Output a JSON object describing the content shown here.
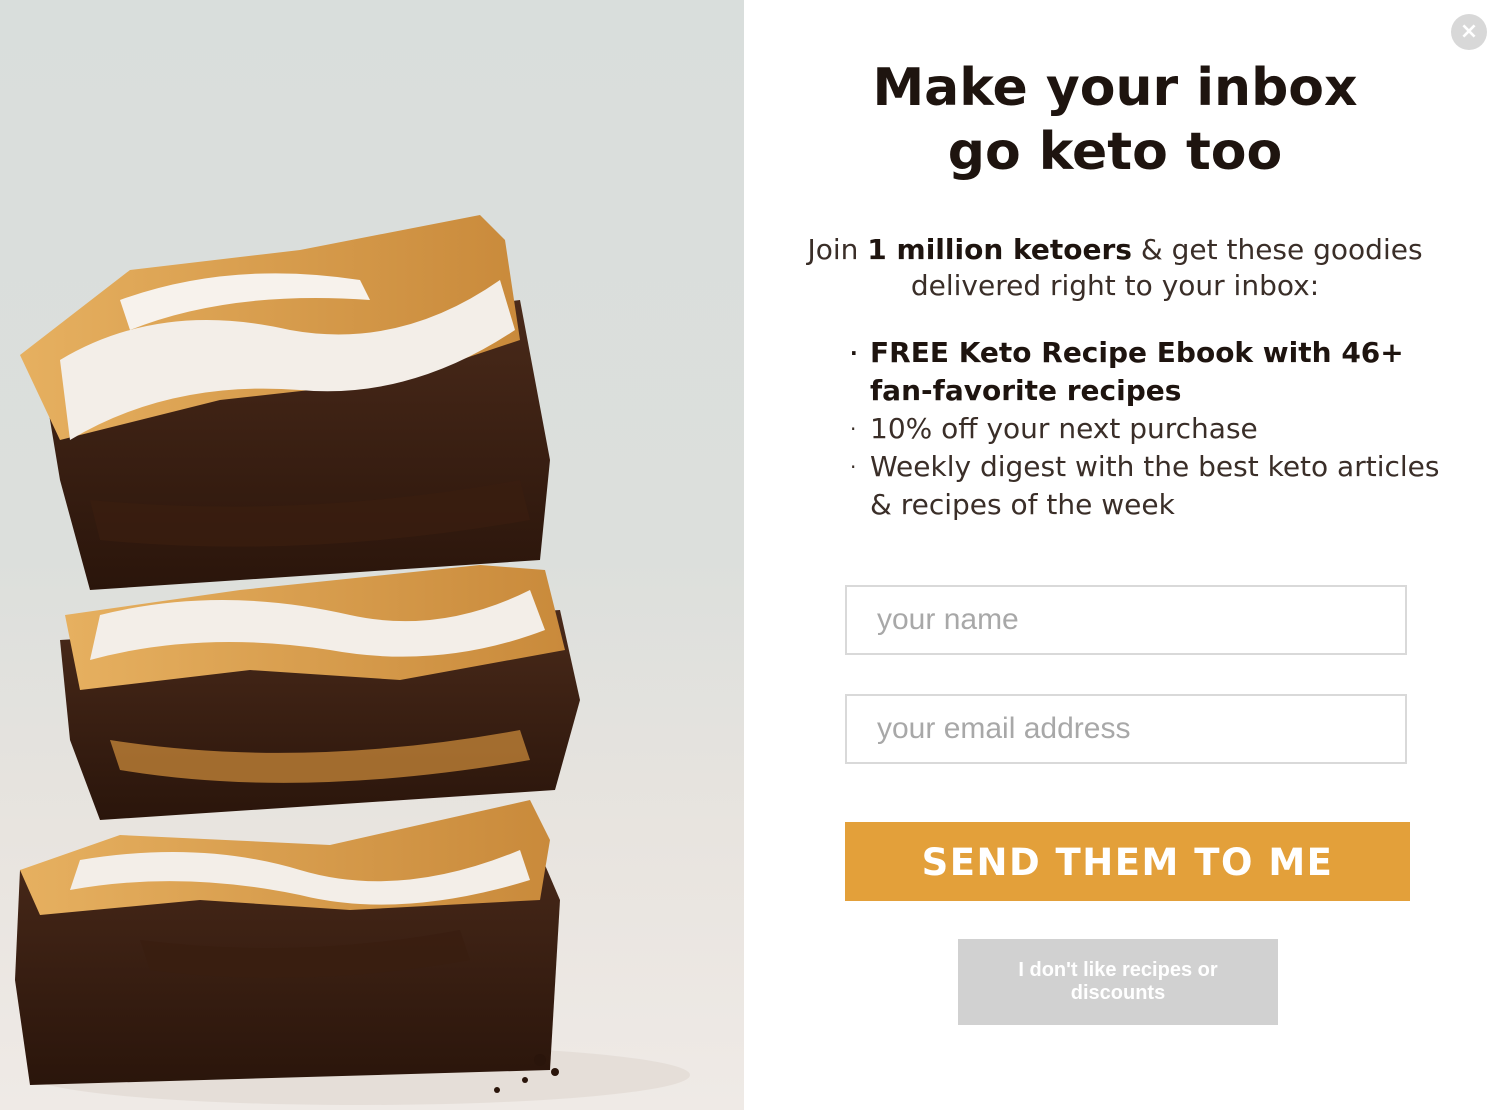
{
  "popup": {
    "close_icon": "×",
    "headline_line1": "Make your inbox",
    "headline_line2": "go keto too",
    "intro_prefix": "Join ",
    "intro_bold": "1 million ketoers",
    "intro_suffix": " & get these goodies delivered right to your inbox:",
    "benefits": [
      {
        "text": "FREE Keto Recipe Ebook with 46+ fan-favorite recipes",
        "bold": true
      },
      {
        "text": "10% off your next purchase",
        "bold": false
      },
      {
        "text": "Weekly digest with the best keto articles & recipes of the week",
        "bold": false
      }
    ],
    "bullet_glyph": "·",
    "name_placeholder": "your name",
    "email_placeholder": "your email address",
    "submit_label": "SEND THEM TO ME",
    "decline_label": "I don't like recipes or discounts"
  },
  "photo": {
    "icon": "brownie-stack-photo"
  },
  "colors": {
    "accent": "#e3a03a",
    "heading": "#1e140f",
    "body_text": "#3a2e28",
    "decline_bg": "#d1d1d1",
    "close_bg": "#d8d8d8"
  }
}
